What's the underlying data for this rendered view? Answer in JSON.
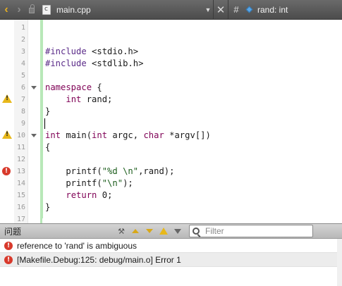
{
  "toolbar": {
    "back_icon": "chevron-left-icon",
    "forward_icon": "chevron-right-icon",
    "file_name": "main.cpp",
    "close_glyph": "✕",
    "hash_glyph": "#",
    "symbol": "rand: int",
    "back_glyph": "‹",
    "forward_glyph": "›",
    "dropdown_glyph": "▼"
  },
  "editor": {
    "lines": [
      {
        "n": "1",
        "text": ""
      },
      {
        "n": "2",
        "text": ""
      },
      {
        "n": "3",
        "text": "#include <stdio.h>"
      },
      {
        "n": "4",
        "text": "#include <stdlib.h>"
      },
      {
        "n": "5",
        "text": ""
      },
      {
        "n": "6",
        "text": "namespace {"
      },
      {
        "n": "7",
        "text": "    int rand;"
      },
      {
        "n": "8",
        "text": "}"
      },
      {
        "n": "9",
        "text": ""
      },
      {
        "n": "10",
        "text": "int main(int argc, char *argv[])"
      },
      {
        "n": "11",
        "text": "{"
      },
      {
        "n": "12",
        "text": ""
      },
      {
        "n": "13",
        "text": "    printf(\"%d \\n\",rand);"
      },
      {
        "n": "14",
        "text": "    printf(\"\\n\");"
      },
      {
        "n": "15",
        "text": "    return 0;"
      },
      {
        "n": "16",
        "text": "}"
      },
      {
        "n": "17",
        "text": ""
      }
    ],
    "markers": {
      "7": "warning",
      "10": "warning",
      "13": "error"
    },
    "fold_lines": [
      "6",
      "10"
    ]
  },
  "issues": {
    "title": "问题",
    "filter_placeholder": "Filter",
    "items": [
      {
        "severity": "error",
        "text": "reference to 'rand' is ambiguous"
      },
      {
        "severity": "error",
        "text": "[Makefile.Debug:125: debug/main.o] Error 1"
      }
    ],
    "build_glyph": "⚒",
    "error_glyph": "!"
  },
  "colors": {
    "toolbar_bg": "#555555",
    "accent_yellow": "#e8b020",
    "error_red": "#d83a2c",
    "warning_yellow": "#e8b81a",
    "keyword": "#7f0055",
    "string": "#1a5c1a",
    "change_bar": "#b8e8b8"
  }
}
